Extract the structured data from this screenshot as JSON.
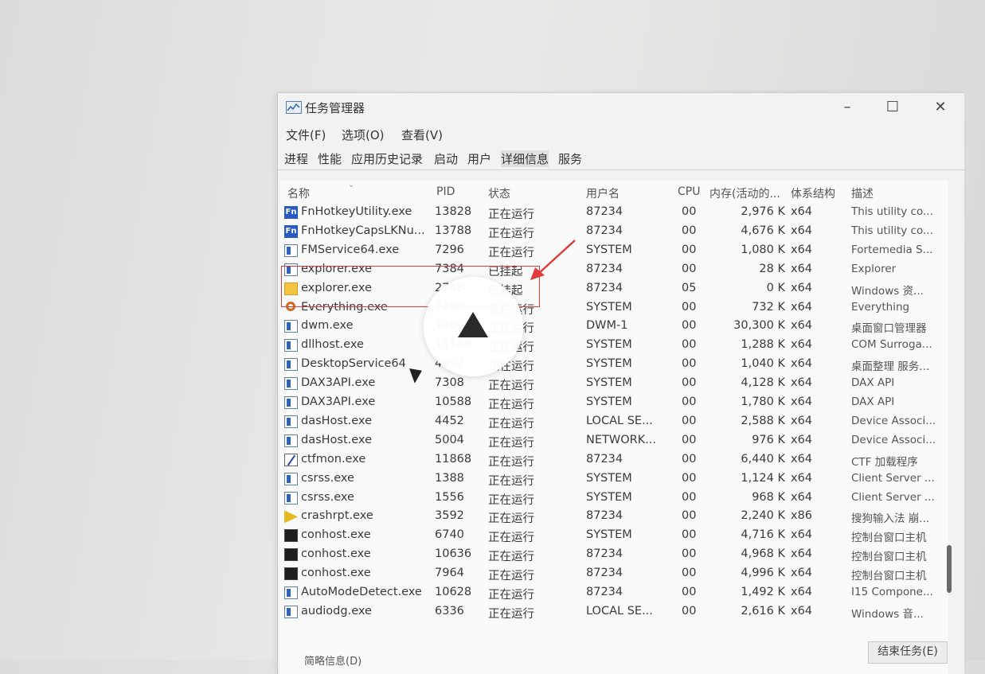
{
  "window": {
    "title": "任务管理器",
    "minimize": "–",
    "maximize": "☐",
    "close": "✕"
  },
  "menu": [
    "文件(F)",
    "选项(O)",
    "查看(V)"
  ],
  "tabs": [
    "进程",
    "性能",
    "应用历史记录",
    "启动",
    "用户",
    "详细信息",
    "服务"
  ],
  "active_tab": "详细信息",
  "columns": [
    "名称",
    "PID",
    "状态",
    "用户名",
    "CPU",
    "内存(活动的...",
    "体系结构",
    "描述"
  ],
  "rows": [
    {
      "icon": "fn-icon",
      "name": "FnHotkeyUtility.exe",
      "pid": "13828",
      "status": "正在运行",
      "user": "87234",
      "cpu": "00",
      "mem": "2,976 K",
      "arch": "x64",
      "desc": "This utility co..."
    },
    {
      "icon": "fn-icon",
      "name": "FnHotkeyCapsLKNu...",
      "pid": "13788",
      "status": "正在运行",
      "user": "87234",
      "cpu": "00",
      "mem": "4,676 K",
      "arch": "x64",
      "desc": "This utility co..."
    },
    {
      "icon": "window-icon",
      "name": "FMService64.exe",
      "pid": "7296",
      "status": "正在运行",
      "user": "SYSTEM",
      "cpu": "00",
      "mem": "1,080 K",
      "arch": "x64",
      "desc": "Fortemedia S..."
    },
    {
      "icon": "window-icon",
      "name": "explorer.exe",
      "pid": "7384",
      "status": "已挂起",
      "user": "87234",
      "cpu": "00",
      "mem": "28 K",
      "arch": "x64",
      "desc": "Explorer"
    },
    {
      "icon": "folder-icon",
      "name": "explorer.exe",
      "pid": "2748",
      "status": "已挂起",
      "user": "87234",
      "cpu": "05",
      "mem": "0 K",
      "arch": "x64",
      "desc": "Windows 资..."
    },
    {
      "icon": "search-icon",
      "name": "Everything.exe",
      "pid": "7760",
      "status": "正在运行",
      "user": "SYSTEM",
      "cpu": "00",
      "mem": "732 K",
      "arch": "x64",
      "desc": "Everything"
    },
    {
      "icon": "window-icon",
      "name": "dwm.exe",
      "pid": "1460",
      "status": "正在运行",
      "user": "DWM-1",
      "cpu": "00",
      "mem": "30,300 K",
      "arch": "x64",
      "desc": "桌面窗口管理器"
    },
    {
      "icon": "window-icon",
      "name": "dllhost.exe",
      "pid": "11188",
      "status": "正在运行",
      "user": "SYSTEM",
      "cpu": "00",
      "mem": "1,288 K",
      "arch": "x64",
      "desc": "COM Surroga..."
    },
    {
      "icon": "window-icon",
      "name": "DesktopService64",
      "pid": "4092",
      "status": "正在运行",
      "user": "SYSTEM",
      "cpu": "00",
      "mem": "1,040 K",
      "arch": "x64",
      "desc": "桌面整理 服务..."
    },
    {
      "icon": "window-icon",
      "name": "DAX3API.exe",
      "pid": "7308",
      "status": "正在运行",
      "user": "SYSTEM",
      "cpu": "00",
      "mem": "4,128 K",
      "arch": "x64",
      "desc": "DAX API"
    },
    {
      "icon": "window-icon",
      "name": "DAX3API.exe",
      "pid": "10588",
      "status": "正在运行",
      "user": "SYSTEM",
      "cpu": "00",
      "mem": "1,780 K",
      "arch": "x64",
      "desc": "DAX API"
    },
    {
      "icon": "window-icon",
      "name": "dasHost.exe",
      "pid": "4452",
      "status": "正在运行",
      "user": "LOCAL SE...",
      "cpu": "00",
      "mem": "2,588 K",
      "arch": "x64",
      "desc": "Device Associ..."
    },
    {
      "icon": "window-icon",
      "name": "dasHost.exe",
      "pid": "5004",
      "status": "正在运行",
      "user": "NETWORK...",
      "cpu": "00",
      "mem": "976 K",
      "arch": "x64",
      "desc": "Device Associ..."
    },
    {
      "icon": "pen-icon",
      "name": "ctfmon.exe",
      "pid": "11868",
      "status": "正在运行",
      "user": "87234",
      "cpu": "00",
      "mem": "6,440 K",
      "arch": "x64",
      "desc": "CTF 加载程序"
    },
    {
      "icon": "window-icon",
      "name": "csrss.exe",
      "pid": "1388",
      "status": "正在运行",
      "user": "SYSTEM",
      "cpu": "00",
      "mem": "1,124 K",
      "arch": "x64",
      "desc": "Client Server ..."
    },
    {
      "icon": "window-icon",
      "name": "csrss.exe",
      "pid": "1556",
      "status": "正在运行",
      "user": "SYSTEM",
      "cpu": "00",
      "mem": "968 K",
      "arch": "x64",
      "desc": "Client Server ..."
    },
    {
      "icon": "crash-icon",
      "name": "crashrpt.exe",
      "pid": "3592",
      "status": "正在运行",
      "user": "87234",
      "cpu": "00",
      "mem": "2,240 K",
      "arch": "x86",
      "desc": "搜狗输入法 崩..."
    },
    {
      "icon": "console-icon",
      "name": "conhost.exe",
      "pid": "6740",
      "status": "正在运行",
      "user": "SYSTEM",
      "cpu": "00",
      "mem": "4,716 K",
      "arch": "x64",
      "desc": "控制台窗口主机"
    },
    {
      "icon": "console-icon",
      "name": "conhost.exe",
      "pid": "10636",
      "status": "正在运行",
      "user": "87234",
      "cpu": "00",
      "mem": "4,968 K",
      "arch": "x64",
      "desc": "控制台窗口主机"
    },
    {
      "icon": "console-icon",
      "name": "conhost.exe",
      "pid": "7964",
      "status": "正在运行",
      "user": "87234",
      "cpu": "00",
      "mem": "4,996 K",
      "arch": "x64",
      "desc": "控制台窗口主机"
    },
    {
      "icon": "window-icon",
      "name": "AutoModeDetect.exe",
      "pid": "10628",
      "status": "正在运行",
      "user": "87234",
      "cpu": "00",
      "mem": "1,492 K",
      "arch": "x64",
      "desc": "I15 Compone..."
    },
    {
      "icon": "window-icon",
      "name": "audiodg.exe",
      "pid": "6336",
      "status": "正在运行",
      "user": "LOCAL SE...",
      "cpu": "00",
      "mem": "2,616 K",
      "arch": "x64",
      "desc": "Windows 音..."
    }
  ],
  "footer": {
    "details_label": "简略信息(D)",
    "end_task_label": "结束任务(E)"
  },
  "colors": {
    "highlight": "#e23b3b",
    "fn_icon": "#2a5bc4"
  }
}
